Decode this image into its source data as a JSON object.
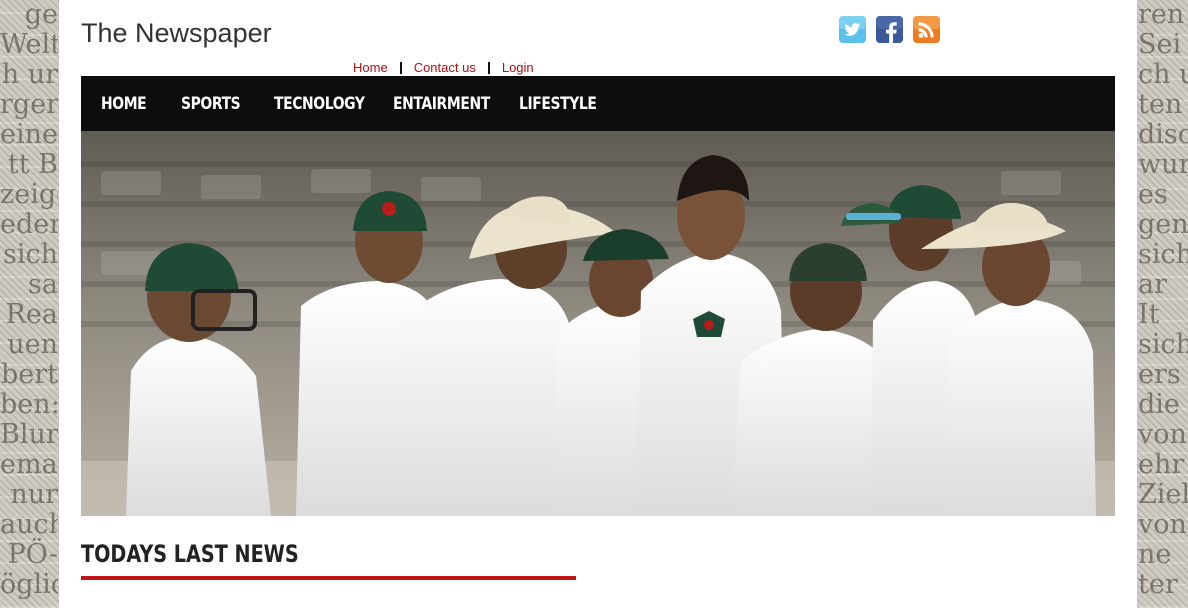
{
  "site": {
    "title": "The Newspaper"
  },
  "social": [
    {
      "icon": "twitter-icon",
      "color": "#4fb8e8"
    },
    {
      "icon": "facebook-icon",
      "color": "#3b5998"
    },
    {
      "icon": "rss-feed-icon",
      "color": "#f07a1a"
    }
  ],
  "top_links": {
    "home": "Home",
    "contact": "Contact us",
    "login": "Login"
  },
  "nav": {
    "home": "HOME",
    "sports": "SPORTS",
    "tech": "TECNOLOGY",
    "ent": "ENTAIRMENT",
    "life": "LIFESTYLE"
  },
  "section": {
    "title": "TODAYS LAST NEWS"
  },
  "colors": {
    "accent": "#c11414",
    "link": "#b01010",
    "nav_bg": "#0d0d0d"
  }
}
